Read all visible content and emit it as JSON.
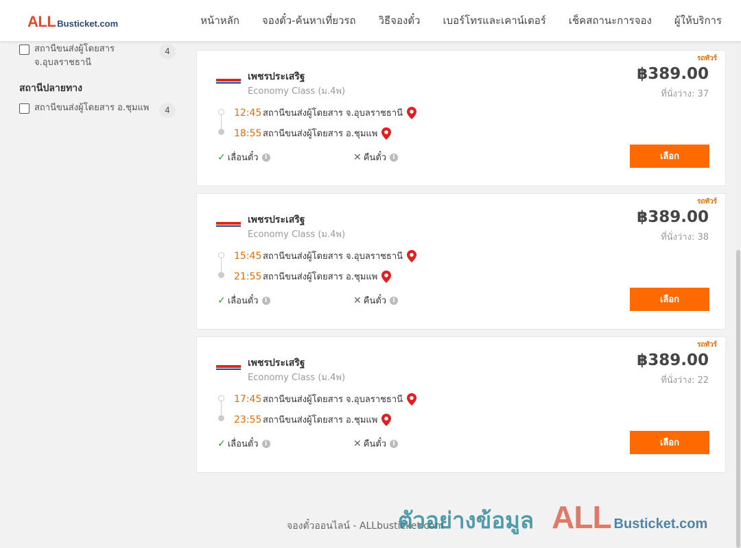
{
  "header": {
    "logo_main": "ALL",
    "logo_rest": "Busticket.com",
    "nav": [
      "หน้าหลัก",
      "จองตั๋ว-ค้นหาเที่ยวรถ",
      "วิธีจองตั๋ว",
      "เบอร์โทรและเคาน์เตอร์",
      "เช็คสถานะการจอง",
      "ผู้ให้บริการ"
    ]
  },
  "sidebar": {
    "origin_filter": {
      "label": "สถานีขนส่งผู้โดยสาร จ.อุบลราชธานี",
      "count": "4"
    },
    "destination_heading": "สถานีปลายทาง",
    "destination_filter": {
      "label": "สถานีขนส่งผู้โดยสาร อ.ชุมแพ",
      "count": "4"
    }
  },
  "trips": [
    {
      "badge": "รถทัวร์",
      "operator": "เพชรประเสริฐ",
      "class": "Economy Class (ม.4พ)",
      "price": "฿389.00",
      "seats": "ที่นั่งว่าง: 37",
      "depart_time": "12:45",
      "depart_station": "สถานีขนส่งผู้โดยสาร จ.อุบลราชธานี",
      "arrive_time": "18:55",
      "arrive_station": "สถานีขนส่งผู้โดยสาร อ.ชุมแพ",
      "feature_reschedule": "เลื่อนตั๋ว",
      "feature_refund": "คืนตั๋ว",
      "select_label": "เลือก"
    },
    {
      "badge": "รถทัวร์",
      "operator": "เพชรประเสริฐ",
      "class": "Economy Class (ม.4พ)",
      "price": "฿389.00",
      "seats": "ที่นั่งว่าง: 38",
      "depart_time": "15:45",
      "depart_station": "สถานีขนส่งผู้โดยสาร จ.อุบลราชธานี",
      "arrive_time": "21:55",
      "arrive_station": "สถานีขนส่งผู้โดยสาร อ.ชุมแพ",
      "feature_reschedule": "เลื่อนตั๋ว",
      "feature_refund": "คืนตั๋ว",
      "select_label": "เลือก"
    },
    {
      "badge": "รถทัวร์",
      "operator": "เพชรประเสริฐ",
      "class": "Economy Class (ม.4พ)",
      "price": "฿389.00",
      "seats": "ที่นั่งว่าง: 22",
      "depart_time": "17:45",
      "depart_station": "สถานีขนส่งผู้โดยสาร จ.อุบลราชธานี",
      "arrive_time": "23:55",
      "arrive_station": "สถานีขนส่งผู้โดยสาร อ.ชุมแพ",
      "feature_reschedule": "เลื่อนตั๋ว",
      "feature_refund": "คืนตั๋ว",
      "select_label": "เลือก"
    }
  ],
  "footer": {
    "text": "จองตั๋วออนไลน์ - ALLbusticket.com"
  },
  "watermark": {
    "thai": "ตัวอย่างข้อมูล",
    "all": "ALL",
    "rest": "Busticket.com"
  },
  "colors": {
    "accent": "#ff6a00",
    "time": "#e56a00",
    "pin": "#e02020",
    "check": "#2a9a3a"
  }
}
